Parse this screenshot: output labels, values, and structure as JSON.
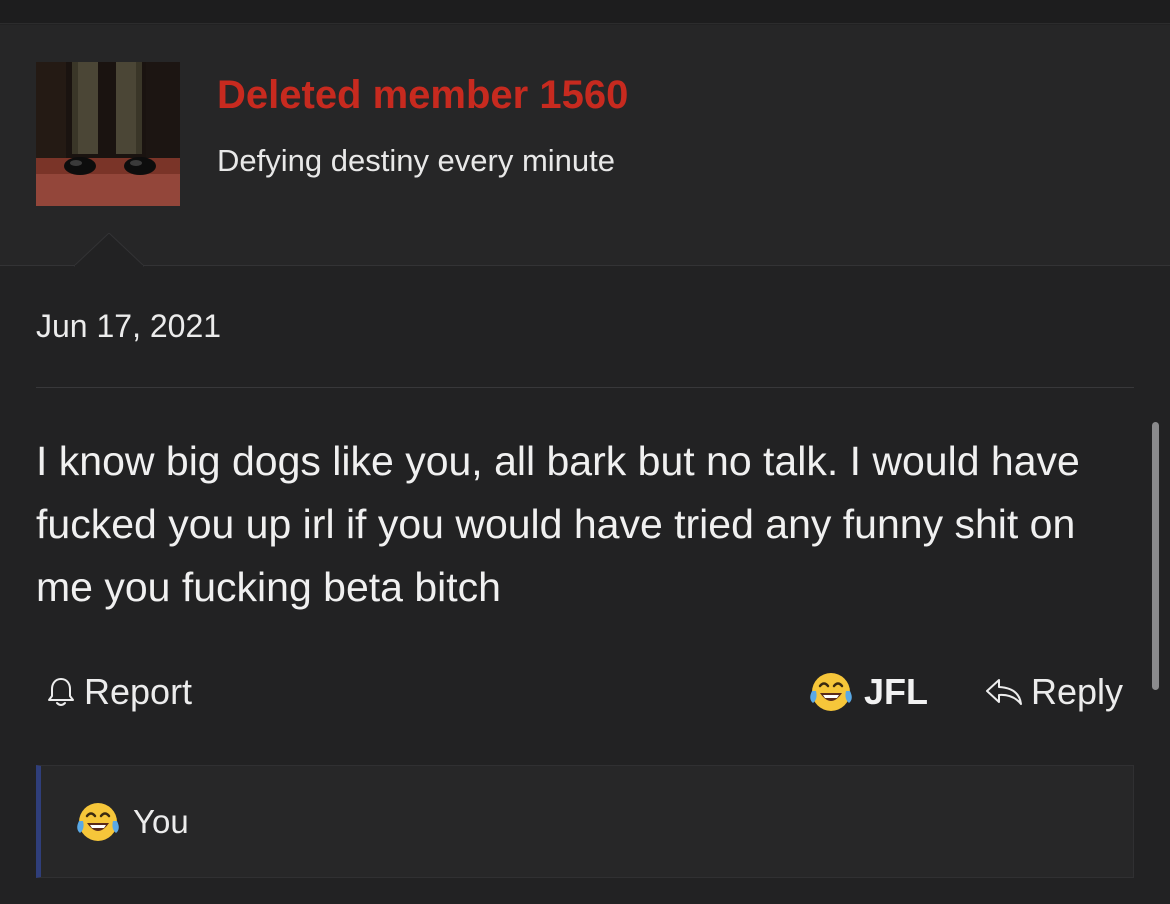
{
  "user": {
    "username": "Deleted member 1560",
    "title": "Defying destiny every minute",
    "avatar_icon": "avatar-image"
  },
  "post": {
    "date": "Jun 17, 2021",
    "body": "I know big dogs like you, all bark but no talk. I would have fucked you up irl if you would have tried any funny shit on me you fucking beta bitch"
  },
  "actions": {
    "report_label": "Report",
    "report_icon": "bell-icon",
    "reaction_label": "JFL",
    "reaction_icon": "laughing-crying-emoji-icon",
    "reply_label": "Reply",
    "reply_icon": "reply-arrow-icon"
  },
  "reactions_summary": {
    "icon": "laughing-crying-emoji-icon",
    "text": "You"
  },
  "colors": {
    "username": "#c72a1f",
    "background": "#222223",
    "header_background": "#262627",
    "reactions_accent": "#2f3e7a"
  }
}
